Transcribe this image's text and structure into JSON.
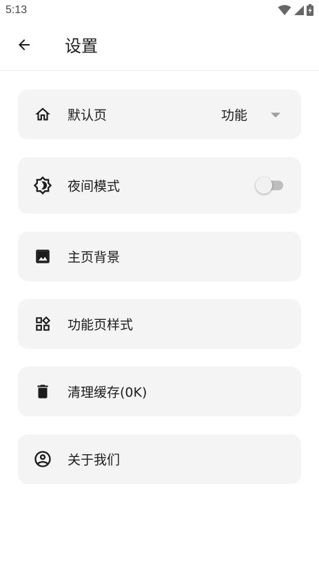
{
  "status_bar": {
    "time": "5:13",
    "icons": [
      "wifi-icon",
      "signal-icon",
      "battery-charging-icon"
    ]
  },
  "app_bar": {
    "back_icon": "arrow-left-icon",
    "title": "设置"
  },
  "settings": {
    "default_page": {
      "icon": "home-icon",
      "label": "默认页",
      "selected_value": "功能",
      "dropdown_icon": "caret-down-icon"
    },
    "night_mode": {
      "icon": "brightness-icon",
      "label": "夜间模式",
      "enabled": false
    },
    "home_background": {
      "icon": "image-icon",
      "label": "主页背景"
    },
    "function_style": {
      "icon": "widgets-icon",
      "label": "功能页样式"
    },
    "clear_cache": {
      "icon": "trash-icon",
      "label": "清理缓存(0K)"
    },
    "about": {
      "icon": "account-circle-icon",
      "label": "关于我们"
    }
  },
  "colors": {
    "card_background": "#f4f4f4",
    "text": "#1c1c1c",
    "toggle_track_off": "#bdbdbd",
    "toggle_thumb_off": "#f1f1f1"
  }
}
